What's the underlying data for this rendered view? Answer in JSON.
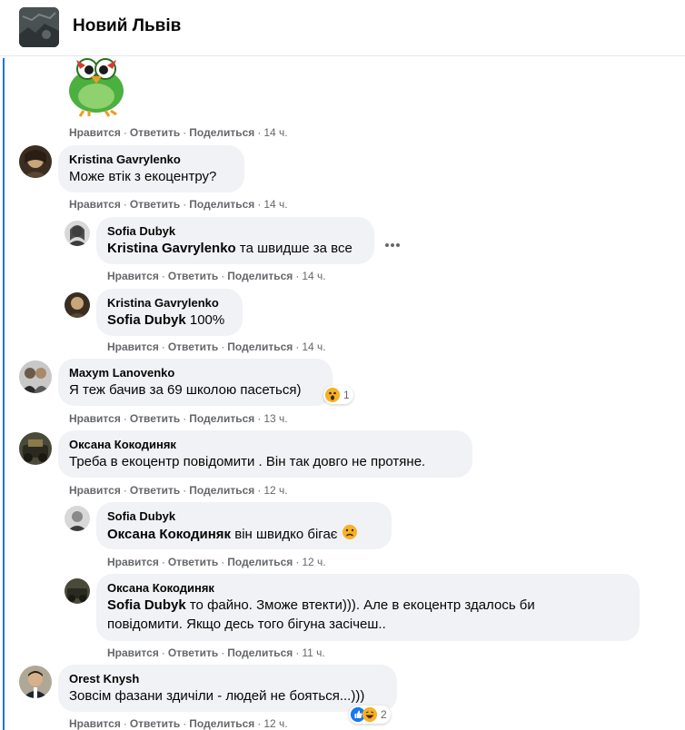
{
  "group": {
    "title": "Новий Львів"
  },
  "labels": {
    "like": "Нравится",
    "reply": "Ответить",
    "share": "Поделиться"
  },
  "comments": [
    {
      "time": "14 ч."
    },
    {
      "author": "Kristina Gavrylenko",
      "text": "Може втік з екоцентру?",
      "time": "14 ч."
    },
    {
      "author": "Sofia Dubyk",
      "mention": "Kristina Gavrylenko",
      "text": " та швидше за все",
      "time": "14 ч."
    },
    {
      "author": "Kristina Gavrylenko",
      "mention": "Sofia Dubyk",
      "text": " 100%",
      "time": "14 ч."
    },
    {
      "author": "Maxym Lanovenko",
      "text": "Я теж бачив за 69 школою пасеться)",
      "time": "13 ч.",
      "reaction_count": "1",
      "reaction_icon": "wow-emoji-icon"
    },
    {
      "author": "Оксана Кокодиняк",
      "text": "Треба в екоцентр повідомити . Він так довго не протяне.",
      "time": "12 ч."
    },
    {
      "author": "Sofia Dubyk",
      "mention": "Оксана Кокодиняк",
      "text": " він швидко бігає",
      "time": "12 ч.",
      "emoji": "sad-emoji-icon"
    },
    {
      "author": "Оксана Кокодиняк",
      "mention": "Sofia Dubyk",
      "text": " то файно. Зможе втекти))). Але в екоцентр здалось би",
      "text2": "повідомити. Якщо десь того бігуна засічеш..",
      "time": "11 ч."
    },
    {
      "author": "Orest Knysh",
      "text": "Зовсім фазани здичіли - людей не бояться...)))",
      "time": "12 ч.",
      "reaction_count": "2",
      "reaction_icon": "like-haha-icons"
    }
  ],
  "colors": {
    "bubble": "#f0f2f5",
    "meta": "#65676b",
    "accent": "#1b74e4"
  }
}
